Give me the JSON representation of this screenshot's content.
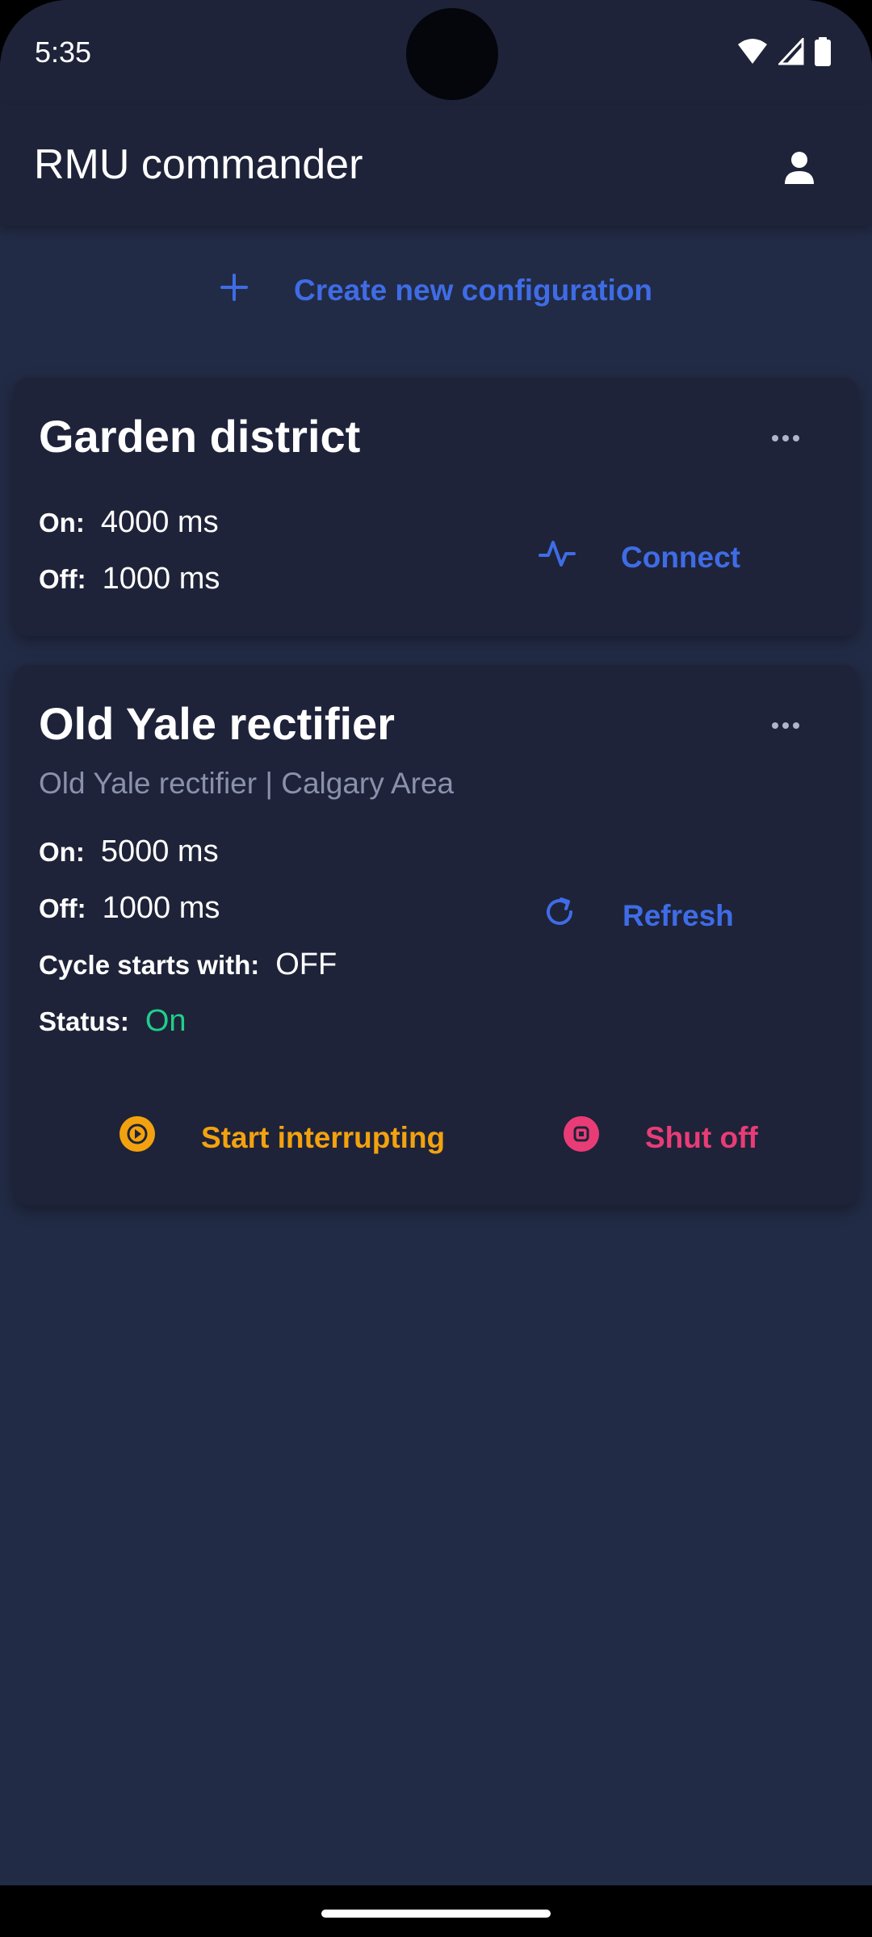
{
  "status_bar": {
    "time": "5:35",
    "icons": [
      "wifi-icon",
      "cell-signal-icon",
      "battery-icon"
    ]
  },
  "app_bar": {
    "title": "RMU commander",
    "profile_icon": "person-icon"
  },
  "create_button": {
    "icon": "plus-icon",
    "label": "Create new configuration"
  },
  "configurations": [
    {
      "name": "Garden district",
      "more_icon": "more-horizontal-icon",
      "fields": [
        {
          "label": "On:",
          "value": "4000 ms"
        },
        {
          "label": "Off:",
          "value": "1000 ms"
        }
      ],
      "action": {
        "icon": "activity-icon",
        "label": "Connect"
      }
    },
    {
      "name": "Old Yale rectifier",
      "subtitle": "Old Yale rectifier | Calgary Area",
      "more_icon": "more-horizontal-icon",
      "fields": [
        {
          "label": "On:",
          "value": "5000 ms"
        },
        {
          "label": "Off:",
          "value": "1000 ms"
        },
        {
          "label": "Cycle starts with:",
          "value": "OFF"
        },
        {
          "label": "Status:",
          "value": "On"
        }
      ],
      "action": {
        "icon": "refresh-icon",
        "label": "Refresh"
      },
      "start_button": {
        "icon": "play-circle-icon",
        "label": "Start interrupting"
      },
      "stop_button": {
        "icon": "stop-circle-icon",
        "label": "Shut off"
      }
    }
  ],
  "colors": {
    "background": "#222b45",
    "surface": "#1e2339",
    "primary": "#3f6ce6",
    "warning": "#f3a20f",
    "danger": "#e93c77",
    "success": "#1fcf8a",
    "hint": "#8a91ab"
  }
}
